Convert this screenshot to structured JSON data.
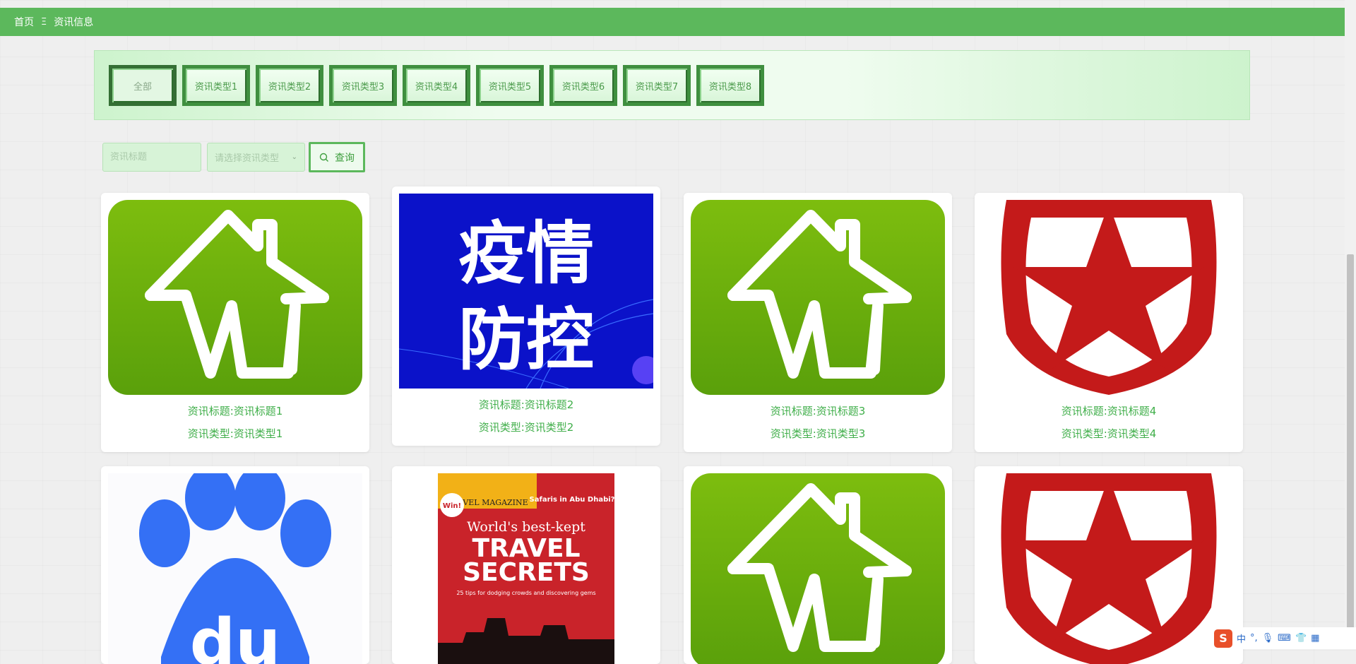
{
  "breadcrumb": {
    "home": "首页",
    "separator": "Ξ",
    "current": "资讯信息"
  },
  "categories": [
    "全部",
    "资讯类型1",
    "资讯类型2",
    "资讯类型3",
    "资讯类型4",
    "资讯类型5",
    "资讯类型6",
    "资讯类型7",
    "资讯类型8"
  ],
  "search": {
    "title_placeholder": "资讯标题",
    "type_placeholder": "请选择资讯类型",
    "query_label": "查询"
  },
  "cards": [
    {
      "title": "资讯标题:资讯标题1",
      "type": "资讯类型:资讯类型1",
      "image": "green-house-logo"
    },
    {
      "title": "资讯标题:资讯标题2",
      "type": "资讯类型:资讯类型2",
      "image": "epidemic-prevention-banner",
      "image_text": [
        "疫情",
        "防控"
      ]
    },
    {
      "title": "资讯标题:资讯标题3",
      "type": "资讯类型:资讯类型3",
      "image": "green-house-logo"
    },
    {
      "title": "资讯标题:资讯标题4",
      "type": "资讯类型:资讯类型4",
      "image": "red-star-shield"
    },
    {
      "image": "baidu-paw-logo",
      "image_text": "du"
    },
    {
      "image": "travel-magazine-cover",
      "image_text": [
        "TRAVEL MAGAZINE",
        "World's best-kept",
        "TRAVEL",
        "SECRETS",
        "25 tips for dodging crowds and discovering gems",
        "Win!",
        "Safaris in Abu Dhabi?"
      ]
    },
    {
      "image": "green-house-logo"
    },
    {
      "image": "red-star-shield"
    }
  ],
  "ime": {
    "mode": "中",
    "logo": "S"
  },
  "colors": {
    "accent": "#5cb85c",
    "link_green": "#3fae49",
    "panel_bg": "#effcef"
  }
}
